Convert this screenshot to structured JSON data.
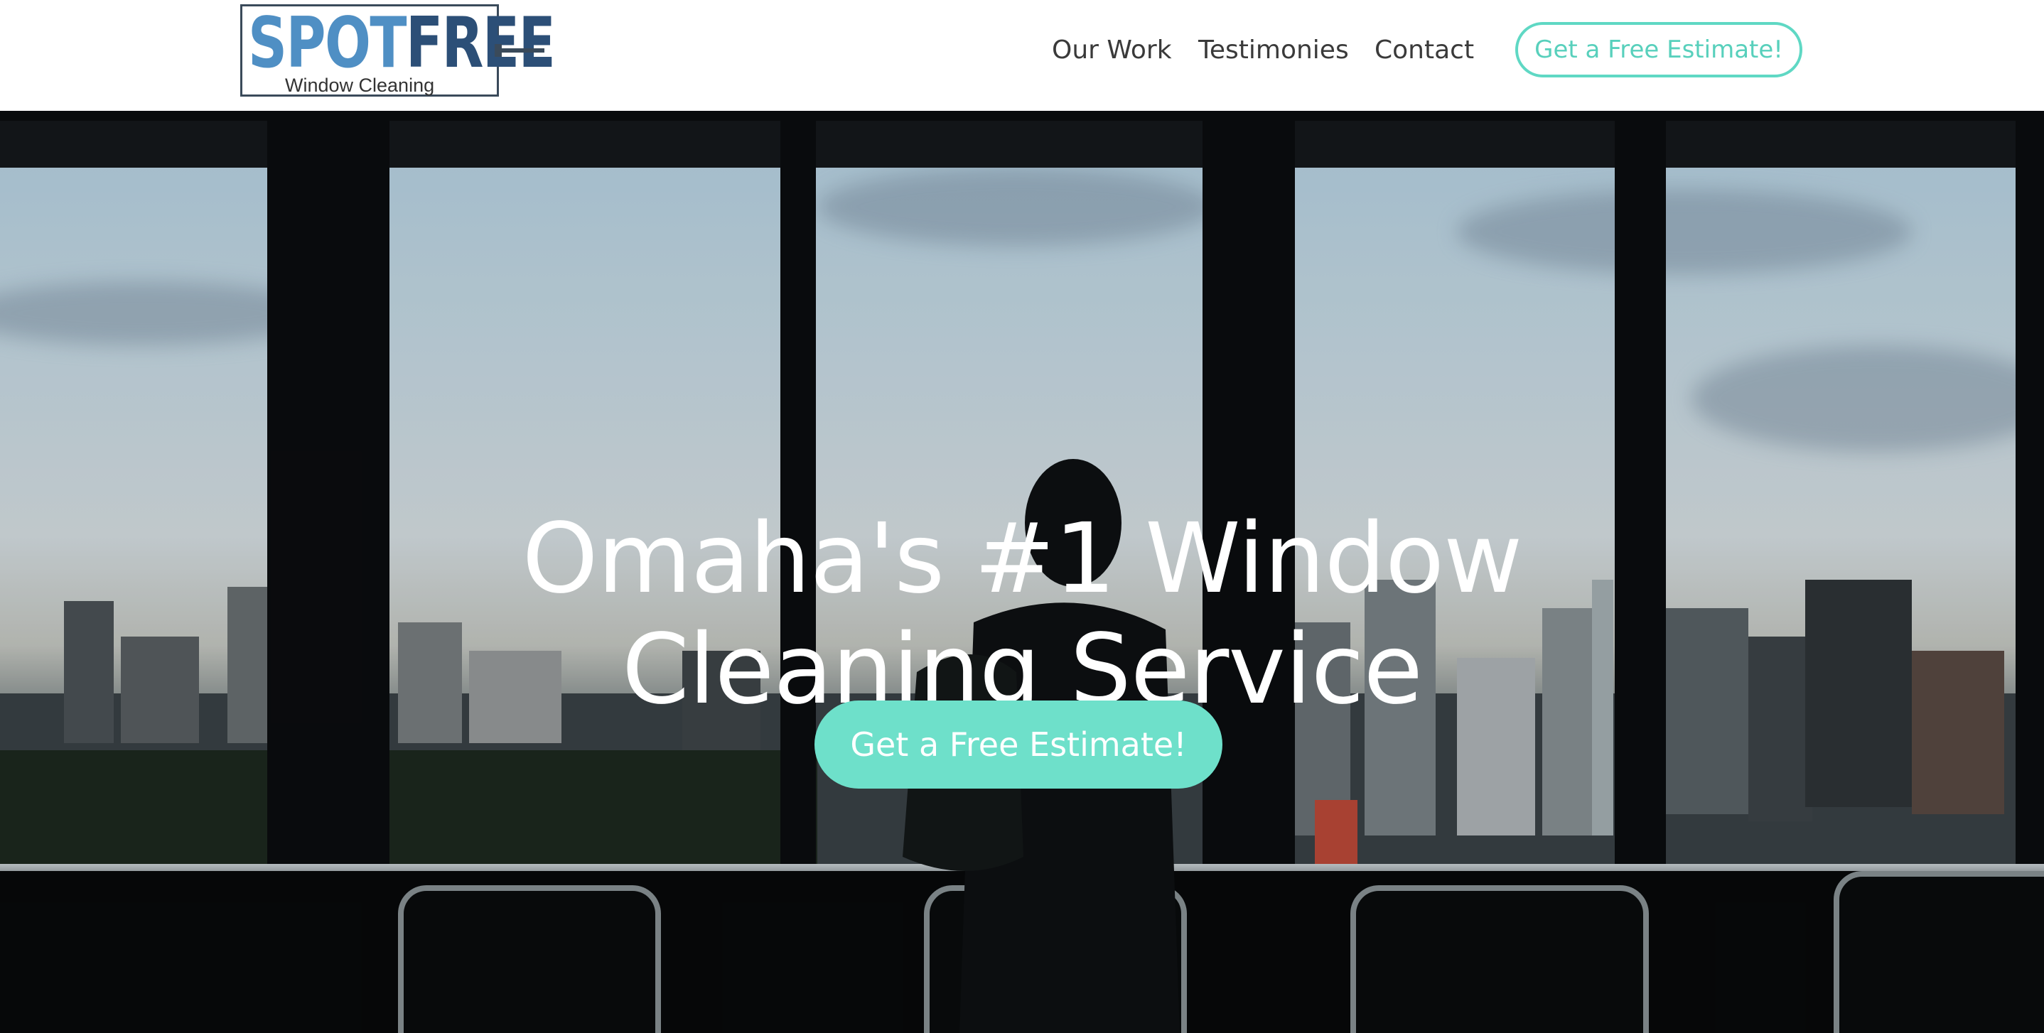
{
  "brand": {
    "word_part1": "SPOT",
    "word_part2": "FREE",
    "subtitle": "Window Cleaning",
    "colors": {
      "spot": "#4f8fc4",
      "free": "#2c4f77"
    }
  },
  "nav": {
    "links": [
      "Our Work",
      "Testimonies",
      "Contact"
    ],
    "cta_label": "Get a Free Estimate!",
    "accent_color": "#5fd8c4"
  },
  "hero": {
    "title_line1": "Omaha's #1 Window",
    "title_line2": "Cleaning Service",
    "cta_label": "Get a Free Estimate!",
    "cta_color": "#6ee0ca"
  }
}
